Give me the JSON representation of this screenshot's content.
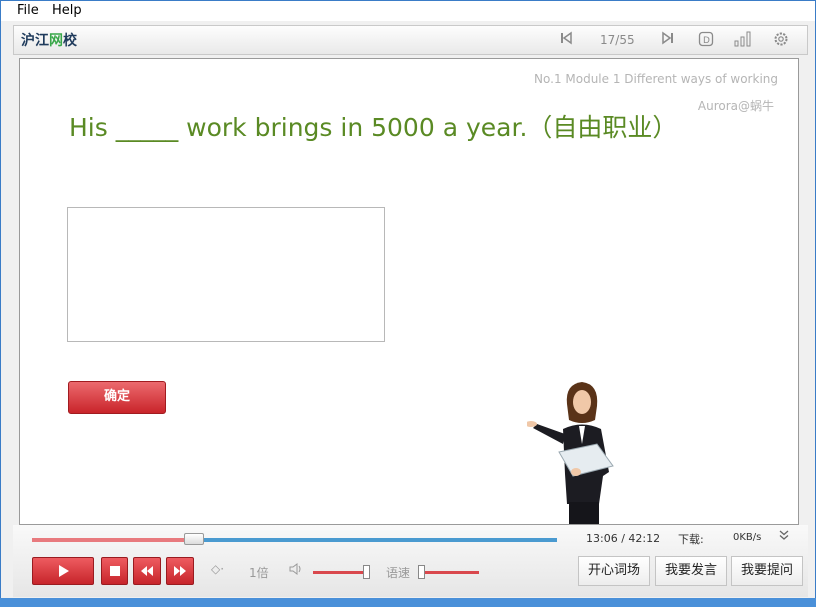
{
  "menu": {
    "file": "File",
    "help": "Help"
  },
  "toolbar": {
    "logo_a": "沪江",
    "logo_b": "网",
    "logo_c": "校",
    "page_counter": "17/55"
  },
  "stage": {
    "module_title": "No.1 Module 1 Different ways of working",
    "author": "Aurora@蜗牛",
    "question": "His _____ work brings in 5000 a year.（自由职业）",
    "answer_value": "",
    "confirm_label": "确定"
  },
  "controls": {
    "time": "13:06 / 42:12",
    "download_label": "下载:",
    "download_speed": "0KB/s",
    "playback_rate": "1倍",
    "speech_speed_label": "语速",
    "progress": 0.31,
    "word_game_label": "开心词场",
    "comment_label": "我要发言",
    "ask_label": "我要提问"
  },
  "colors": {
    "question": "#5a8a24",
    "accent_red": "#c9242a",
    "progress_blue": "#4a9ad0"
  },
  "icons": [
    "prev-page-icon",
    "next-page-icon",
    "dictionary-icon",
    "stats-icon",
    "settings-icon",
    "play-icon",
    "stop-icon",
    "rewind-icon",
    "fast-forward-icon",
    "volume-icon",
    "diamond-icon"
  ]
}
